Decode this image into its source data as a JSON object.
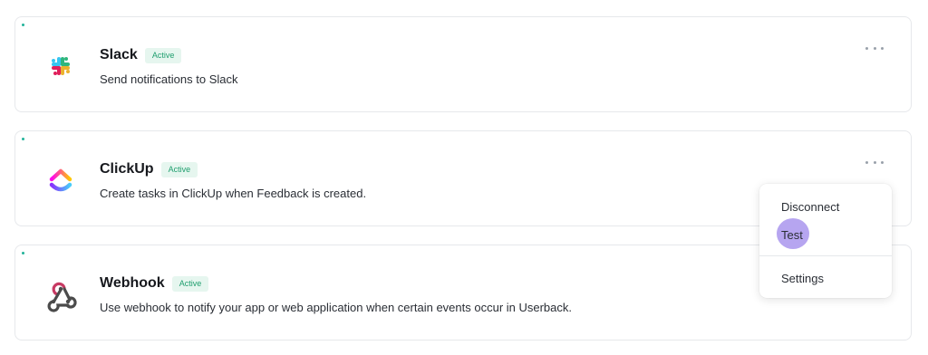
{
  "integrations": [
    {
      "name": "Slack",
      "status": "Active",
      "description": "Send notifications to Slack",
      "icon": "slack-logo"
    },
    {
      "name": "ClickUp",
      "status": "Active",
      "description": "Create tasks in ClickUp when Feedback is created.",
      "icon": "clickup-logo"
    },
    {
      "name": "Webhook",
      "status": "Active",
      "description": "Use webhook to notify your app or web application when certain events occur in Userback.",
      "icon": "webhook-logo"
    }
  ],
  "menu": {
    "items": [
      "Disconnect",
      "Test",
      "Settings"
    ]
  },
  "colors": {
    "active_badge_text": "#1f9e6e",
    "active_badge_bg": "#e6f6ef",
    "status_dot": "#22b39a",
    "menu_highlight": "#b6a5f0"
  }
}
